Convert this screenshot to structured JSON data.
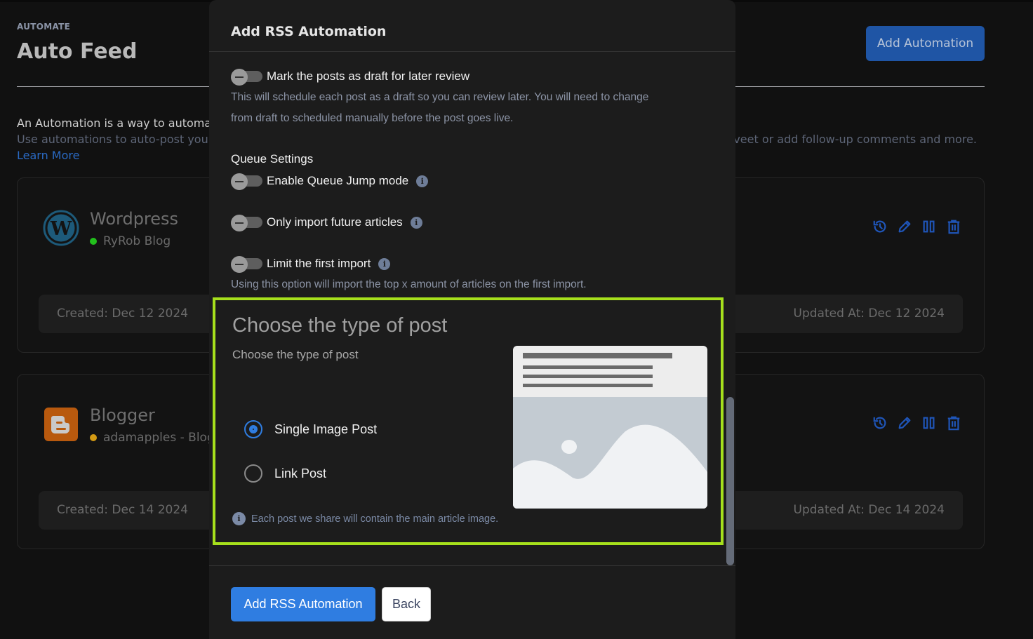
{
  "page": {
    "eyebrow": "AUTOMATE",
    "title": "Auto Feed",
    "add_automation_label": "Add Automation",
    "intro_line1": "An Automation is a way to automa",
    "intro_line2_left": "Use automations to auto-post you",
    "intro_line2_right": "veet or add follow-up comments and more.",
    "learn_more": "Learn More"
  },
  "automations": [
    {
      "name": "Wordpress",
      "icon": "wordpress-icon",
      "account": "RyRob Blog",
      "status_color": "#22c01c",
      "created": "Created: Dec 12 2024",
      "updated": "Updated At: Dec 12 2024"
    },
    {
      "name": "Blogger",
      "icon": "blogger-icon",
      "account": "adamapples - Blog",
      "status_color": "#d39a14",
      "created": "Created: Dec 14 2024",
      "updated": "Updated At: Dec 14 2024"
    }
  ],
  "card_actions": [
    "history-icon",
    "edit-icon",
    "pause-icon",
    "delete-icon"
  ],
  "modal": {
    "title": "Add RSS Automation",
    "draft_toggle": {
      "label": "Mark the posts as draft for later review",
      "enabled": false,
      "helper_line1": "This will schedule each post as a draft so you can review later. You will need to change",
      "helper_line2": "from draft to scheduled manually before the post goes live."
    },
    "queue_section_label": "Queue Settings",
    "queue_jump_toggle": {
      "label": "Enable Queue Jump mode",
      "enabled": false
    },
    "future_articles_toggle": {
      "label": "Only import future articles",
      "enabled": false
    },
    "limit_import_toggle": {
      "label": "Limit the first import",
      "enabled": false,
      "helper": "Using this option will import the top x amount of articles on the first import."
    },
    "post_type": {
      "title": "Choose the type of post",
      "subtitle": "Choose the type of post",
      "options": [
        {
          "label": "Single Image Post",
          "selected": true
        },
        {
          "label": "Link Post",
          "selected": false
        }
      ],
      "note": "Each post we share will contain the main article image.",
      "highlight_color": "#a6e01c"
    },
    "submit_label": "Add RSS Automation",
    "back_label": "Back"
  },
  "colors": {
    "accent": "#2f7de1",
    "action_icons": "#1f55b8"
  }
}
